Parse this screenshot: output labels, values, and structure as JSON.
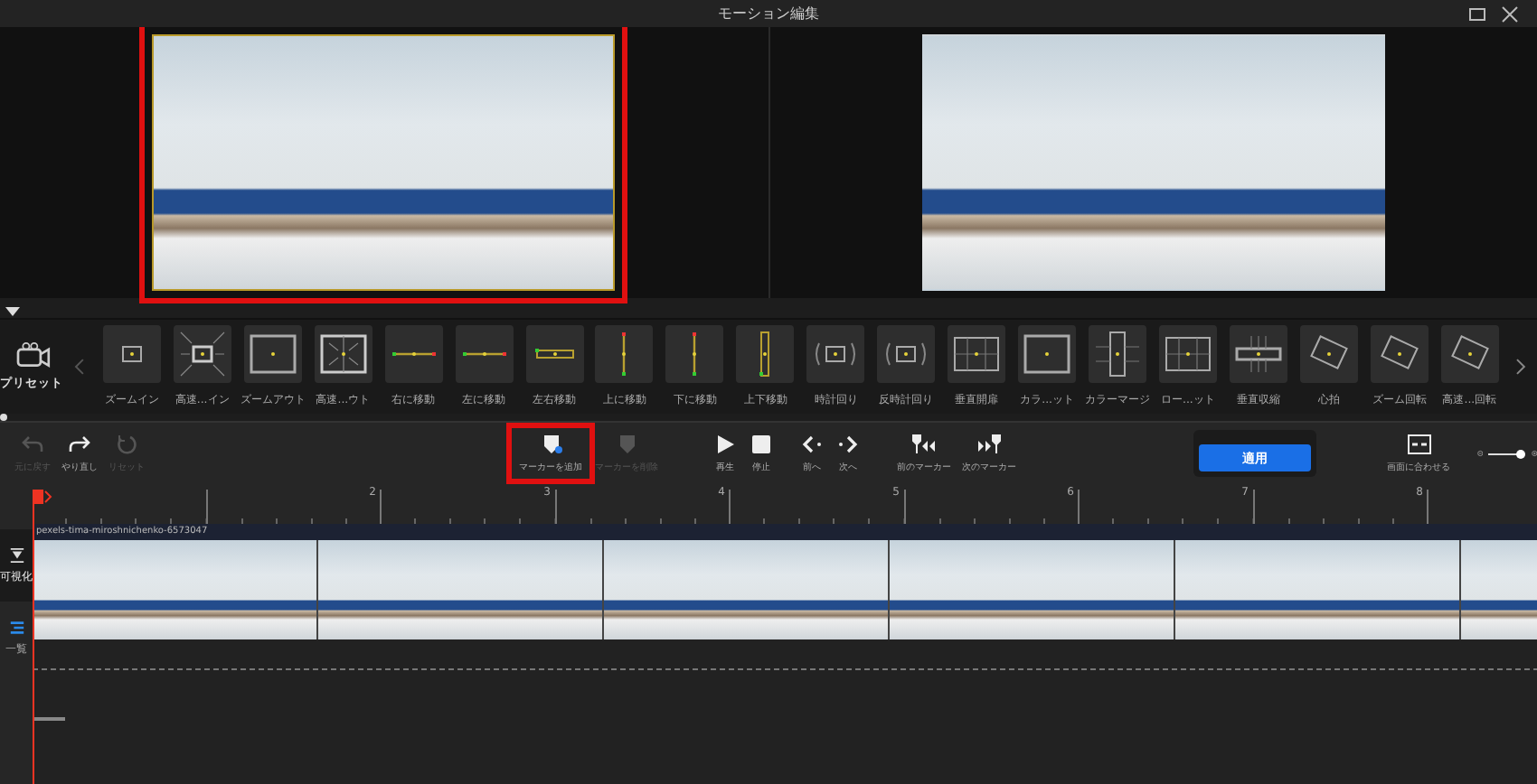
{
  "window": {
    "title": "モーション編集"
  },
  "previews": [
    {
      "highlighted": true
    },
    {
      "highlighted": false
    }
  ],
  "presets": {
    "label": "プリセット",
    "items": [
      {
        "label": "ズームイン",
        "kind": "zoom-in"
      },
      {
        "label": "高速...イン",
        "kind": "zoom-in-fast"
      },
      {
        "label": "ズームアウト",
        "kind": "zoom-out"
      },
      {
        "label": "高速...ウト",
        "kind": "zoom-out-fast"
      },
      {
        "label": "右に移動",
        "kind": "move-h"
      },
      {
        "label": "左に移動",
        "kind": "move-h"
      },
      {
        "label": "左右移動",
        "kind": "move-hh"
      },
      {
        "label": "上に移動",
        "kind": "move-v"
      },
      {
        "label": "下に移動",
        "kind": "move-v"
      },
      {
        "label": "上下移動",
        "kind": "move-vv"
      },
      {
        "label": "時計回り",
        "kind": "rotate"
      },
      {
        "label": "反時計回り",
        "kind": "rotate"
      },
      {
        "label": "垂直開扉",
        "kind": "split"
      },
      {
        "label": "カラ...ット",
        "kind": "zoom-out"
      },
      {
        "label": "カラーマージ",
        "kind": "narrow"
      },
      {
        "label": "ロー...ット",
        "kind": "split"
      },
      {
        "label": "垂直収縮",
        "kind": "band"
      },
      {
        "label": "心拍",
        "kind": "tilt"
      },
      {
        "label": "ズーム回転",
        "kind": "tilt"
      },
      {
        "label": "高速...回転",
        "kind": "tilt"
      }
    ]
  },
  "toolbar": {
    "items": [
      {
        "label": "元に戻す",
        "kind": "undo",
        "disabled": true,
        "highlighted": false
      },
      {
        "label": "やり直し",
        "kind": "redo",
        "disabled": false,
        "highlighted": false
      },
      {
        "label": "リセット",
        "kind": "reset",
        "disabled": true,
        "highlighted": false
      },
      {
        "label": "マーカーを追加",
        "kind": "add-marker",
        "disabled": false,
        "highlighted": true
      },
      {
        "label": "マーカーを削除",
        "kind": "remove-marker",
        "disabled": true,
        "highlighted": false
      },
      {
        "label": "再生",
        "kind": "play",
        "disabled": false,
        "highlighted": false
      },
      {
        "label": "停止",
        "kind": "stop",
        "disabled": false,
        "highlighted": false
      },
      {
        "label": "前へ",
        "kind": "prev",
        "disabled": false,
        "highlighted": false
      },
      {
        "label": "次へ",
        "kind": "next",
        "disabled": false,
        "highlighted": false
      },
      {
        "label": "前のマーカー",
        "kind": "prev-marker",
        "disabled": false,
        "highlighted": false
      },
      {
        "label": "次のマーカー",
        "kind": "next-marker",
        "disabled": false,
        "highlighted": false
      }
    ],
    "apply": "適用",
    "fit": "画面に合わせる",
    "zoom": {
      "level": 0.95
    }
  },
  "sidebar": [
    {
      "label": "可視化",
      "kind": "visualize",
      "selected": true
    },
    {
      "label": "一覧",
      "kind": "list",
      "selected": false
    }
  ],
  "timeline": {
    "ruler": [
      "2",
      "3",
      "4",
      "5",
      "6",
      "7",
      "8"
    ],
    "clip": {
      "name": "pexels-tima-miroshnichenko-6573047"
    }
  }
}
